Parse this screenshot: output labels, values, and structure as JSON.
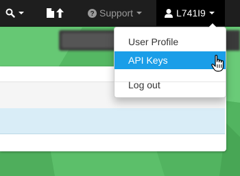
{
  "navbar": {
    "search_icon": "search-icon",
    "upload_icon": "file-upload-icon",
    "support": {
      "label": "Support",
      "icon": "question-circle-icon"
    },
    "user": {
      "label": "L741I9",
      "icon": "user-icon"
    }
  },
  "user_menu": {
    "items": [
      {
        "label": "User Profile",
        "active": false
      },
      {
        "label": "API Keys",
        "active": true
      },
      {
        "label": "Log out",
        "active": false
      }
    ]
  },
  "colors": {
    "navbar": "#1e1e1e",
    "accent_active": "#1a9ee8",
    "background_green": "#5cbf6a",
    "row_highlight": "#d9edf7"
  }
}
